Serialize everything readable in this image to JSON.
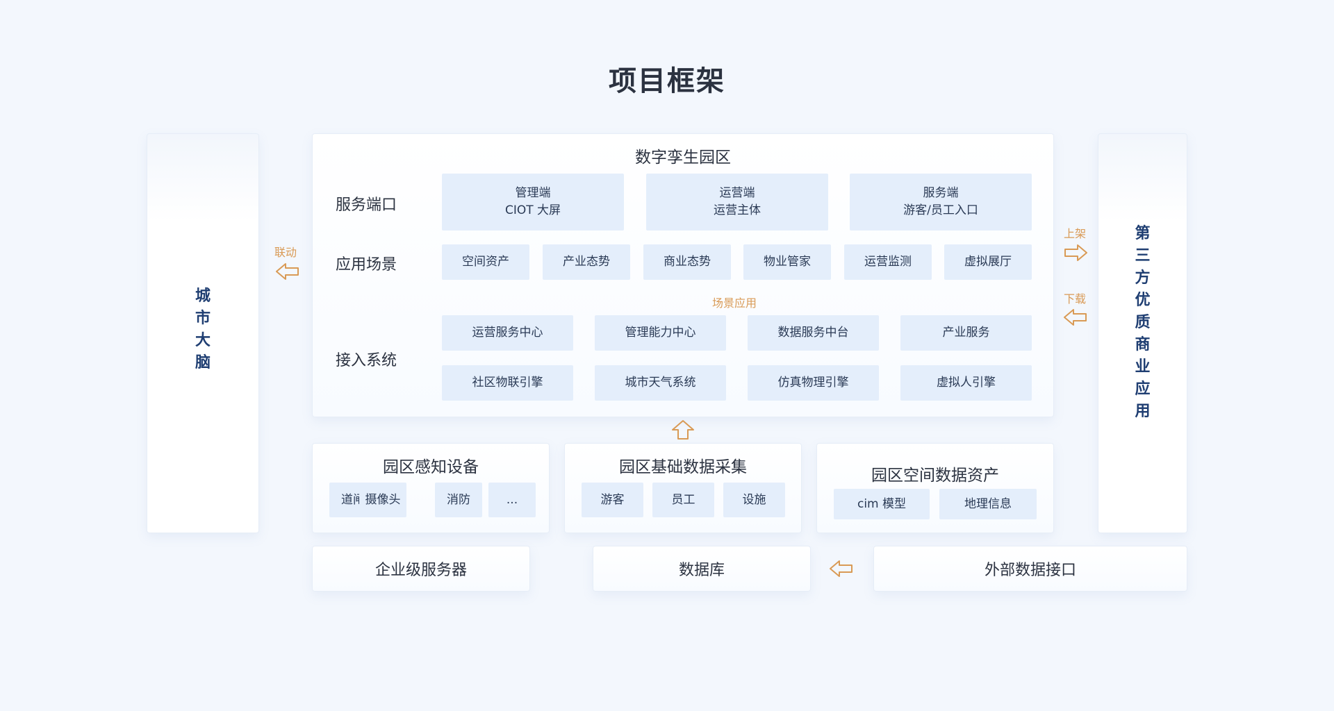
{
  "title": "项目框架",
  "left_panel": {
    "chars": [
      "城",
      "市",
      "大",
      "脑"
    ]
  },
  "right_panel": {
    "chars": [
      "第",
      "三",
      "方",
      "优",
      "质",
      "商",
      "业",
      "应",
      "用"
    ]
  },
  "labels": {
    "link": "联动",
    "list": "上架",
    "download": "下载",
    "scene_app": "场景应用"
  },
  "twin_park": {
    "title": "数字孪生园区",
    "service_ports": {
      "label": "服务端口",
      "items": [
        {
          "line1": "管理端",
          "line2": "CIOT 大屏"
        },
        {
          "line1": "运营端",
          "line2": "运营主体"
        },
        {
          "line1": "服务端",
          "line2": "游客/员工入口"
        }
      ]
    },
    "scenes": {
      "label": "应用场景",
      "items": [
        "空间资产",
        "产业态势",
        "商业态势",
        "物业管家",
        "运营监测",
        "虚拟展厅"
      ]
    },
    "access": {
      "label": "接入系统",
      "row1": [
        "运营服务中心",
        "管理能力中心",
        "数据服务中台",
        "产业服务"
      ],
      "row2": [
        "社区物联引擎",
        "城市天气系统",
        "仿真物理引擎",
        "虚拟人引擎"
      ]
    }
  },
  "sensing": {
    "title": "园区感知设备",
    "items": [
      "道闸",
      "摄像头",
      "消防",
      "..."
    ]
  },
  "collection": {
    "title": "园区基础数据采集",
    "items": [
      "游客",
      "员工",
      "设施"
    ]
  },
  "spatial": {
    "title": "园区空间数据资产",
    "items": [
      "cim 模型",
      "地理信息"
    ]
  },
  "bottom": {
    "server": "企业级服务器",
    "database": "数据库",
    "external": "外部数据接口"
  },
  "colors": {
    "accent_orange": "#d99a55",
    "box_blue": "#e4eefb",
    "dark_blue_text": "#1f3e72"
  }
}
